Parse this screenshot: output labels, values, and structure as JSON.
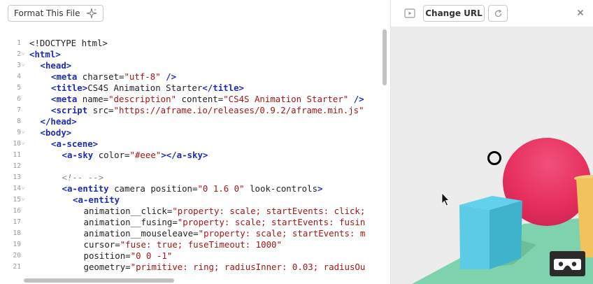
{
  "editor": {
    "format_button": "Format This File",
    "lines": [
      {
        "n": "1",
        "fold": false,
        "indent": 0,
        "parts": [
          [
            "plain",
            "<!DOCTYPE html>"
          ]
        ]
      },
      {
        "n": "2",
        "fold": true,
        "indent": 0,
        "parts": [
          [
            "tag",
            "<html>"
          ]
        ]
      },
      {
        "n": "3",
        "fold": true,
        "indent": 1,
        "parts": [
          [
            "tag",
            "<head>"
          ]
        ]
      },
      {
        "n": "4",
        "fold": false,
        "indent": 2,
        "parts": [
          [
            "tag",
            "<meta"
          ],
          [
            "attr",
            " charset="
          ],
          [
            "str",
            "\"utf-8\""
          ],
          [
            "tag",
            " />"
          ]
        ]
      },
      {
        "n": "5",
        "fold": false,
        "indent": 2,
        "parts": [
          [
            "tag",
            "<title>"
          ],
          [
            "plain",
            "CS4S Animation Starter"
          ],
          [
            "tag",
            "</title>"
          ]
        ]
      },
      {
        "n": "6",
        "fold": false,
        "indent": 2,
        "parts": [
          [
            "tag",
            "<meta"
          ],
          [
            "attr",
            " name="
          ],
          [
            "str",
            "\"description\""
          ],
          [
            "attr",
            " content="
          ],
          [
            "str",
            "\"CS4S Animation Starter\""
          ],
          [
            "tag",
            " />"
          ]
        ]
      },
      {
        "n": "7",
        "fold": false,
        "indent": 2,
        "parts": [
          [
            "tag",
            "<script"
          ],
          [
            "attr",
            " src="
          ],
          [
            "str",
            "\"https://aframe.io/releases/0.9.2/aframe.min.js\""
          ]
        ]
      },
      {
        "n": "8",
        "fold": false,
        "indent": 1,
        "parts": [
          [
            "tag",
            "</head>"
          ]
        ]
      },
      {
        "n": "9",
        "fold": true,
        "indent": 1,
        "parts": [
          [
            "tag",
            "<body>"
          ]
        ]
      },
      {
        "n": "10",
        "fold": true,
        "indent": 2,
        "parts": [
          [
            "tag",
            "<a-scene>"
          ]
        ]
      },
      {
        "n": "11",
        "fold": false,
        "indent": 3,
        "parts": [
          [
            "tag",
            "<a-sky"
          ],
          [
            "attr",
            " color="
          ],
          [
            "str",
            "\"#eee\""
          ],
          [
            "tag",
            "></a-sky>"
          ]
        ]
      },
      {
        "n": "12",
        "fold": false,
        "indent": 0,
        "parts": []
      },
      {
        "n": "13",
        "fold": false,
        "indent": 3,
        "parts": [
          [
            "cmt",
            "<!-- -->"
          ]
        ]
      },
      {
        "n": "14",
        "fold": true,
        "indent": 3,
        "parts": [
          [
            "tag",
            "<a-entity"
          ],
          [
            "attr",
            " camera position="
          ],
          [
            "str",
            "\"0 1.6 0\""
          ],
          [
            "attr",
            " look-controls"
          ],
          [
            "tag",
            ">"
          ]
        ]
      },
      {
        "n": "15",
        "fold": true,
        "indent": 4,
        "parts": [
          [
            "tag",
            "<a-entity"
          ]
        ]
      },
      {
        "n": "16",
        "fold": false,
        "indent": 5,
        "parts": [
          [
            "attr",
            "animation__click="
          ],
          [
            "str",
            "\"property: scale; startEvents: click;"
          ]
        ]
      },
      {
        "n": "17",
        "fold": false,
        "indent": 5,
        "parts": [
          [
            "attr",
            "animation__fusing="
          ],
          [
            "str",
            "\"property: scale; startEvents: fusin"
          ]
        ]
      },
      {
        "n": "18",
        "fold": false,
        "indent": 5,
        "parts": [
          [
            "attr",
            "animation__mouseleave="
          ],
          [
            "str",
            "\"property: scale; startEvents: m"
          ]
        ]
      },
      {
        "n": "19",
        "fold": false,
        "indent": 5,
        "parts": [
          [
            "attr",
            "cursor="
          ],
          [
            "str",
            "\"fuse: true; fuseTimeout: 1000\""
          ]
        ]
      },
      {
        "n": "20",
        "fold": false,
        "indent": 5,
        "parts": [
          [
            "attr",
            "position="
          ],
          [
            "str",
            "\"0 0 -1\""
          ]
        ]
      },
      {
        "n": "21",
        "fold": false,
        "indent": 5,
        "parts": [
          [
            "attr",
            "geometry="
          ],
          [
            "str",
            "\"primitive: ring; radiusInner: 0.03; radiusOu"
          ]
        ]
      }
    ]
  },
  "preview": {
    "change_url_button": "Change URL"
  },
  "colors": {
    "sky": "#ececec",
    "sphere": "#ef2d5e",
    "box": "#4cc3d9",
    "cylinder": "#ffc65d",
    "plane": "#7bc8a4"
  }
}
